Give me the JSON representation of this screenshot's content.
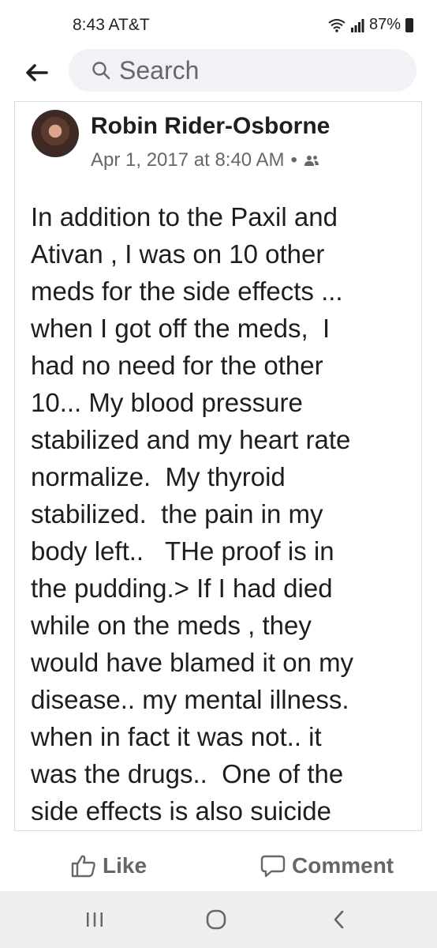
{
  "status_bar": {
    "time_carrier": "8:43 AT&T",
    "battery": "87%",
    "icons": [
      "wifi-icon",
      "signal-icon",
      "battery-icon"
    ]
  },
  "header": {
    "back_icon": "arrow-left-icon",
    "search_placeholder": "Search"
  },
  "post": {
    "author": "Robin Rider-Osborne",
    "timestamp": "Apr 1, 2017 at 8:40 AM",
    "separator": "•",
    "audience_icon": "friends-icon",
    "text_lines": [
      "In addition to the Paxil and",
      "Ativan , I was on 10 other",
      "meds for the side effects ...",
      "when I got off the meds,  I",
      "had no need for the other",
      "10... My blood pressure",
      "stabilized and my heart rate",
      "normalize.  My thyroid",
      "stabilized.  the pain in my",
      "body left..   THe proof is in",
      "the pudding.> If I had died",
      "while on the meds , they",
      "would have blamed it on my",
      "disease.. my mental illness.",
      "when in fact it was not.. it",
      "was the drugs..  One of the",
      "side effects is also suicide"
    ]
  },
  "actions": {
    "like_label": "Like",
    "comment_label": "Comment"
  },
  "nav": {
    "icons": [
      "recent-apps-icon",
      "home-icon",
      "back-icon"
    ]
  },
  "colors": {
    "text": "#1c1e21",
    "secondary": "#65676b",
    "search_bg": "#f0f2f5",
    "nav_bg": "#eeeeee"
  }
}
